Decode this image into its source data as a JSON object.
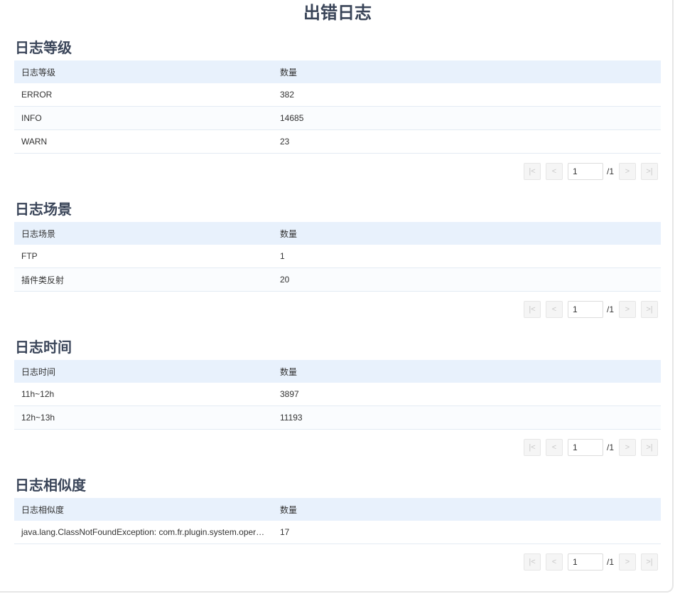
{
  "page_title": "出错日志",
  "sections": [
    {
      "title": "日志等级",
      "columns": [
        "日志等级",
        "数量"
      ],
      "rows": [
        [
          "ERROR",
          "382"
        ],
        [
          "INFO",
          "14685"
        ],
        [
          "WARN",
          "23"
        ]
      ],
      "pager": {
        "page": "1",
        "total": "/1"
      }
    },
    {
      "title": "日志场景",
      "columns": [
        "日志场景",
        "数量"
      ],
      "rows": [
        [
          "FTP",
          "1"
        ],
        [
          "插件类反射",
          "20"
        ]
      ],
      "pager": {
        "page": "1",
        "total": "/1"
      }
    },
    {
      "title": "日志时间",
      "columns": [
        "日志时间",
        "数量"
      ],
      "rows": [
        [
          "11h~12h",
          "3897"
        ],
        [
          "12h~13h",
          "11193"
        ]
      ],
      "pager": {
        "page": "1",
        "total": "/1"
      }
    },
    {
      "title": "日志相似度",
      "columns": [
        "日志相似度",
        "数量"
      ],
      "rows": [
        [
          "java.lang.ClassNotFoundException: com.fr.plugin.system.operat…",
          "17"
        ]
      ],
      "pager": {
        "page": "1",
        "total": "/1"
      }
    }
  ],
  "icons": {
    "first": "first-page-icon",
    "prev": "prev-page-icon",
    "next": "next-page-icon",
    "last": "last-page-icon"
  },
  "colors": {
    "title": "#3a4559",
    "header_bg": "#e8f1fc",
    "row_border": "#e3ebf3"
  }
}
